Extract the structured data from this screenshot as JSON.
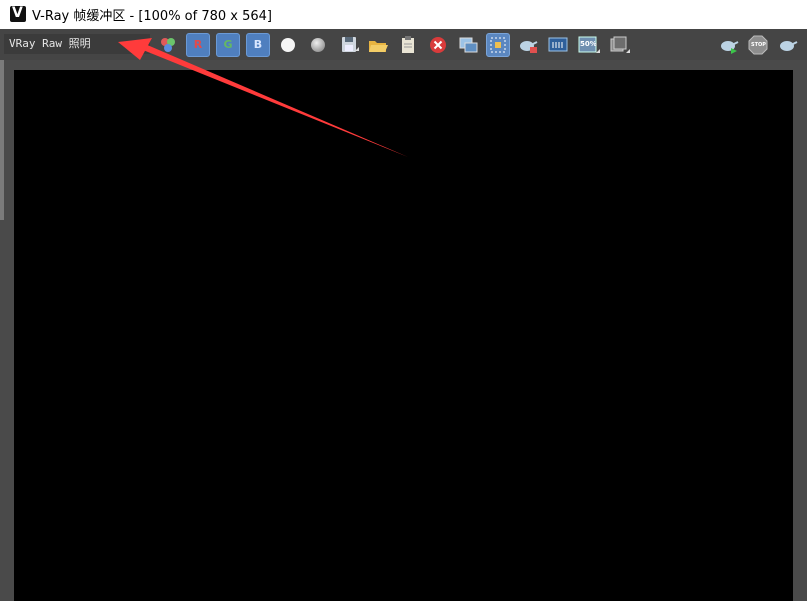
{
  "window": {
    "title": "V-Ray 帧缓冲区 - [100% of 780 x 564]",
    "logo_glyph": "V"
  },
  "toolbar": {
    "channel_select": {
      "value": "VRay Raw 照明",
      "arrow": "▼"
    },
    "channel_r": "R",
    "channel_g": "G",
    "channel_b": "B",
    "zoom_label": "50%",
    "stop_label": "STOP"
  },
  "colors": {
    "annotation_arrow": "#ff3b3b",
    "channel_button_bg": "#4f7fbf",
    "toolbar_bg": "#454545",
    "render_bg": "#000000"
  },
  "icons": [
    "color-channels-icon",
    "show-red-channel-icon",
    "show-green-channel-icon",
    "show-blue-channel-icon",
    "mono-white-icon",
    "mono-gray-icon",
    "save-icon",
    "open-folder-icon",
    "clipboard-icon",
    "clear-image-icon",
    "copy-to-max-icon",
    "region-render-icon",
    "teapot-render-icon",
    "display-correction-icon",
    "zoom-50-icon",
    "history-icon",
    "render-teapot-icon",
    "stop-icon",
    "render-last-icon"
  ]
}
